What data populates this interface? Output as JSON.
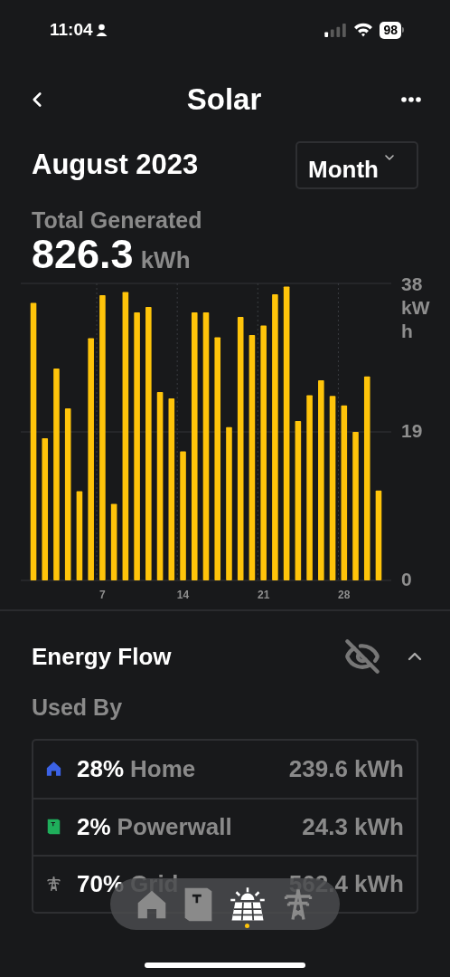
{
  "status_bar": {
    "time": "11:04",
    "battery": "98"
  },
  "header": {
    "title": "Solar"
  },
  "period": {
    "title": "August 2023",
    "selector": "Month"
  },
  "summary": {
    "label": "Total Generated",
    "value": "826.3",
    "unit": "kWh"
  },
  "chart_data": {
    "type": "bar",
    "ylabel": "kWh",
    "ylim": [
      0,
      38
    ],
    "yticks": [
      0,
      19,
      38
    ],
    "x": [
      1,
      2,
      3,
      4,
      5,
      6,
      7,
      8,
      9,
      10,
      11,
      12,
      13,
      14,
      15,
      16,
      17,
      18,
      19,
      20,
      21,
      22,
      23,
      24,
      25,
      26,
      27,
      28,
      29,
      30,
      31
    ],
    "xlim": [
      -0.1,
      32.1
    ],
    "xticks": [
      7,
      14,
      21,
      28
    ],
    "values": [
      35.5,
      18.2,
      27.1,
      22.0,
      11.4,
      31.0,
      36.5,
      9.8,
      36.9,
      34.3,
      35.0,
      24.1,
      23.3,
      16.5,
      34.3,
      34.3,
      31.1,
      19.6,
      33.7,
      31.4,
      32.6,
      36.6,
      37.6,
      20.4,
      23.7,
      25.6,
      23.6,
      22.4,
      19.0,
      26.1,
      11.5
    ]
  },
  "energy_flow": {
    "title": "Energy Flow",
    "expanded": true,
    "subtitle": "Used By",
    "rows": [
      {
        "kind": "home",
        "percent": "28%",
        "name": "Home",
        "value": "239.6 kWh",
        "color": "#3b62e6"
      },
      {
        "kind": "powerwall",
        "percent": "2%",
        "name": "Powerwall",
        "value": "24.3 kWh",
        "color": "#1fae5b"
      },
      {
        "kind": "grid",
        "percent": "70%",
        "name": "Grid",
        "value": "562.4 kWh",
        "color": "#8a8a8a"
      }
    ]
  },
  "tab_bar": {
    "tabs": [
      {
        "kind": "home",
        "selected": false
      },
      {
        "kind": "powerwall",
        "selected": false
      },
      {
        "kind": "solar",
        "selected": true
      },
      {
        "kind": "grid",
        "selected": false
      }
    ]
  }
}
